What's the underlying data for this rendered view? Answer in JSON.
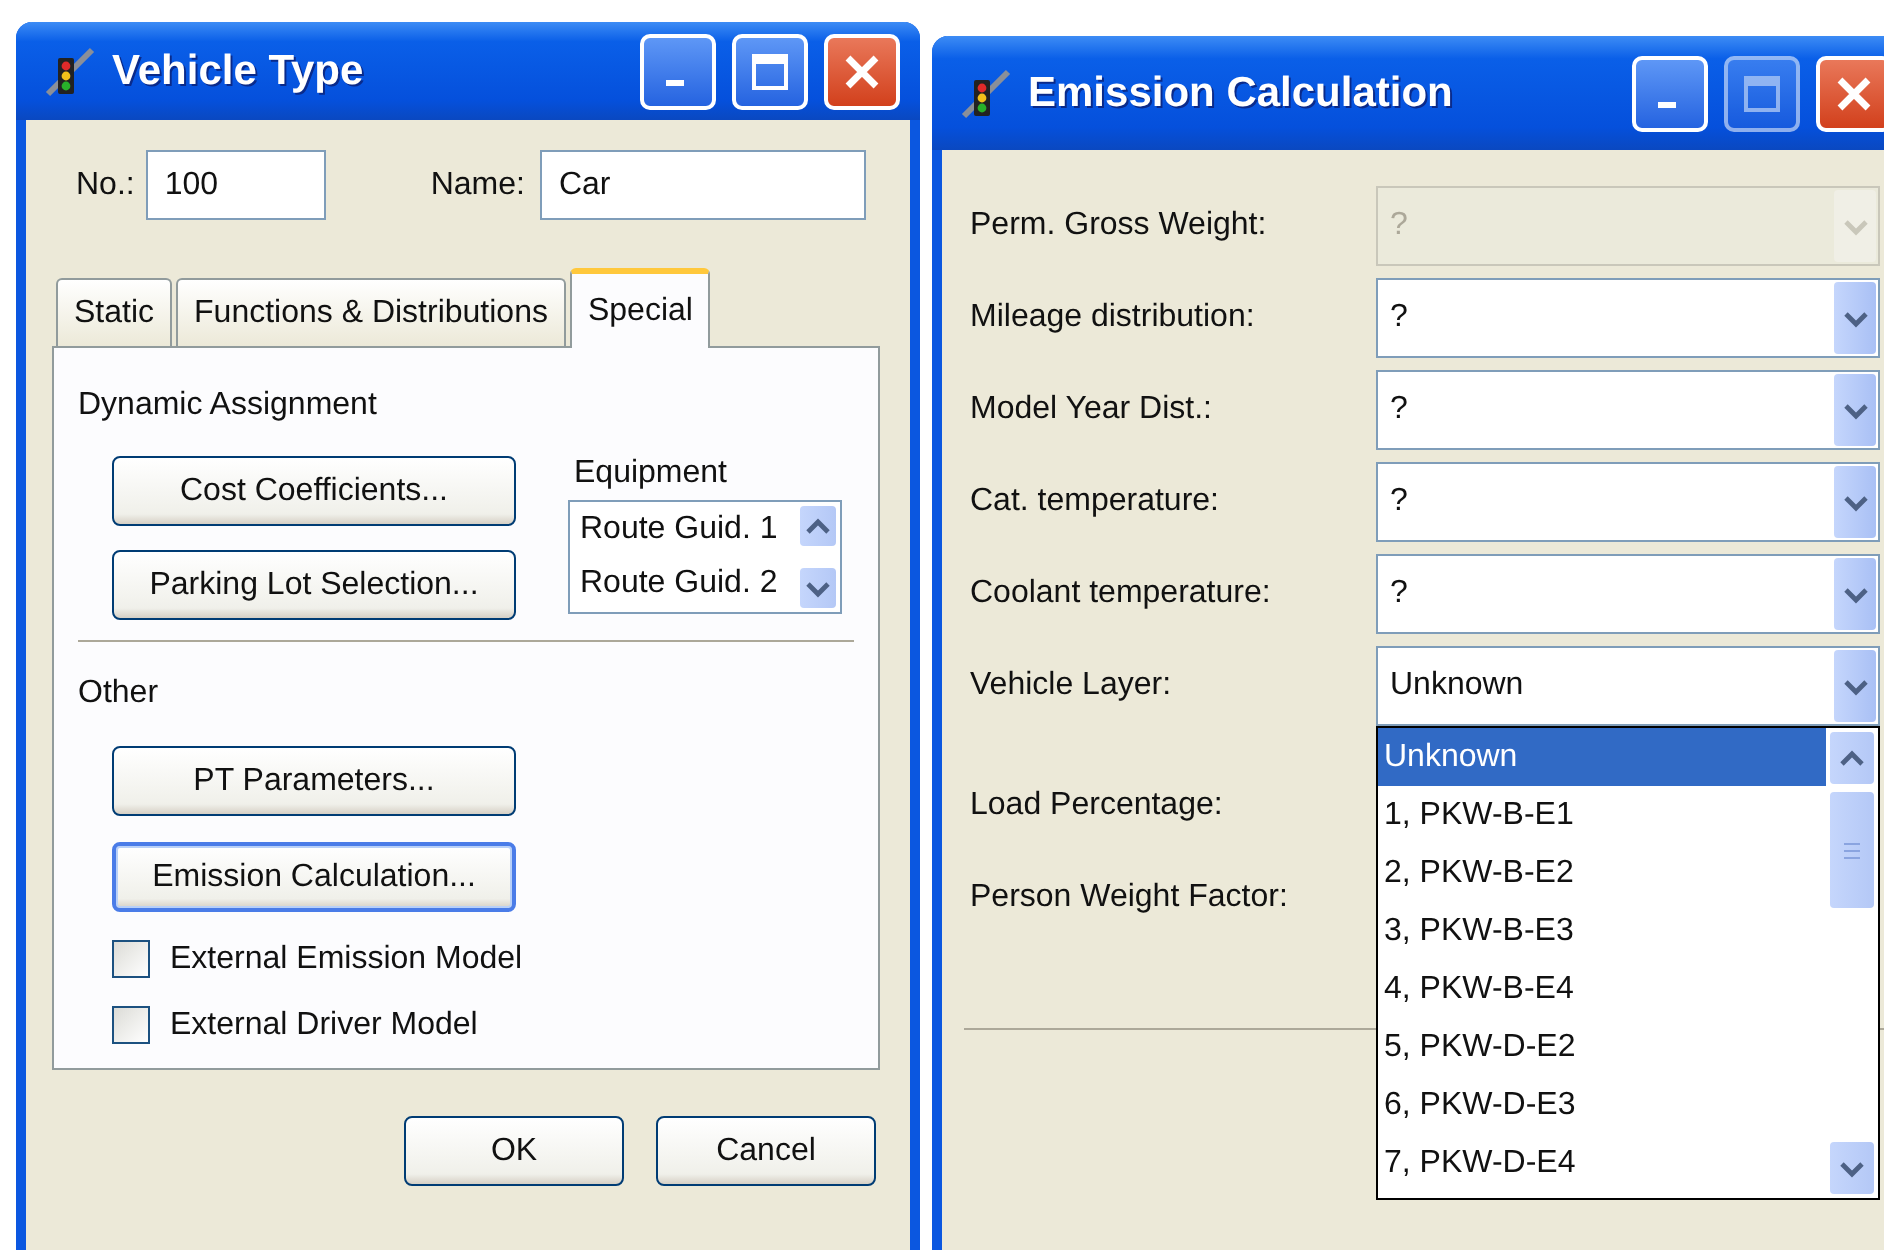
{
  "vehicle_type": {
    "title": "Vehicle Type",
    "maximize_enabled": true,
    "number": {
      "label": "No.:",
      "value": "100"
    },
    "name": {
      "label": "Name:",
      "value": "Car"
    },
    "tabs": [
      {
        "label": "Static",
        "selected": false
      },
      {
        "label": "Functions & Distributions",
        "selected": false
      },
      {
        "label": "Special",
        "selected": true
      }
    ],
    "dynamic_assignment": {
      "heading": "Dynamic Assignment",
      "buttons": [
        "Cost Coefficients...",
        "Parking Lot Selection..."
      ],
      "equipment": {
        "label": "Equipment",
        "items": [
          "Route Guid. 1",
          "Route Guid. 2"
        ]
      }
    },
    "other": {
      "heading": "Other",
      "buttons": [
        {
          "label": "PT Parameters...",
          "focused": false
        },
        {
          "label": "Emission Calculation...",
          "focused": true
        }
      ],
      "checkboxes": [
        {
          "label": "External Emission Model",
          "checked": false
        },
        {
          "label": "External Driver Model",
          "checked": false
        }
      ]
    },
    "buttons": [
      "OK",
      "Cancel"
    ]
  },
  "emission_calculation": {
    "title": "Emission Calculation",
    "maximize_enabled": false,
    "fields": [
      {
        "kind": "combo",
        "label": "Perm. Gross Weight:",
        "value": "?",
        "disabled": true,
        "open": false
      },
      {
        "kind": "combo",
        "label": "Mileage distribution:",
        "value": "?",
        "disabled": false,
        "open": false
      },
      {
        "kind": "combo",
        "label": "Model Year Dist.:",
        "value": "?",
        "disabled": false,
        "open": false
      },
      {
        "kind": "combo",
        "label": "Cat. temperature:",
        "value": "?",
        "disabled": false,
        "open": false
      },
      {
        "kind": "combo",
        "label": "Coolant temperature:",
        "value": "?",
        "disabled": false,
        "open": false
      },
      {
        "kind": "combo",
        "label": "Vehicle Layer:",
        "value": "Unknown",
        "disabled": false,
        "open": true
      },
      {
        "kind": "hidden",
        "label": "Load Percentage:"
      },
      {
        "kind": "hidden",
        "label": "Person Weight Factor:"
      }
    ],
    "dropdown": [
      {
        "label": "Unknown",
        "selected": true
      },
      {
        "label": "1, PKW-B-E1",
        "selected": false
      },
      {
        "label": "2, PKW-B-E2",
        "selected": false
      },
      {
        "label": "3, PKW-B-E3",
        "selected": false
      },
      {
        "label": "4, PKW-B-E4",
        "selected": false
      },
      {
        "label": "5, PKW-D-E2",
        "selected": false
      },
      {
        "label": "6, PKW-D-E3",
        "selected": false
      },
      {
        "label": "7, PKW-D-E4",
        "selected": false
      }
    ]
  }
}
